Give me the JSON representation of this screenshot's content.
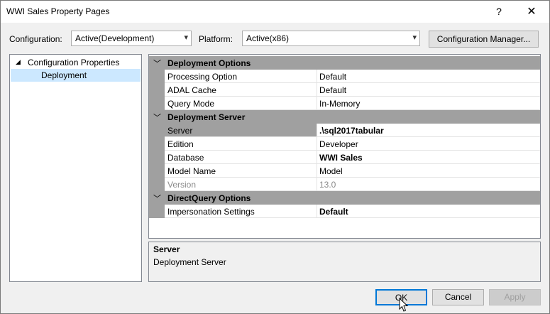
{
  "window": {
    "title": "WWI Sales Property Pages"
  },
  "titlebar": {
    "help": "?",
    "close": "✕"
  },
  "toolbar": {
    "configuration_label": "Configuration:",
    "configuration_value": "Active(Development)",
    "platform_label": "Platform:",
    "platform_value": "Active(x86)",
    "config_manager_label": "Configuration Manager..."
  },
  "tree": {
    "root": {
      "label": "Configuration Properties",
      "expander": "◢"
    },
    "child": {
      "label": "Deployment"
    }
  },
  "grid": {
    "categories": [
      {
        "label": "Deployment Options"
      },
      {
        "label": "Deployment Server"
      },
      {
        "label": "DirectQuery Options"
      }
    ],
    "rows": [
      {
        "name": "Processing Option",
        "value": "Default"
      },
      {
        "name": "ADAL Cache",
        "value": "Default"
      },
      {
        "name": "Query Mode",
        "value": "In-Memory"
      },
      {
        "name": "Server",
        "value": ".\\sql2017tabular"
      },
      {
        "name": "Edition",
        "value": "Developer"
      },
      {
        "name": "Database",
        "value": "WWI Sales"
      },
      {
        "name": "Model Name",
        "value": "Model"
      },
      {
        "name": "Version",
        "value": "13.0"
      },
      {
        "name": "Impersonation Settings",
        "value": "Default"
      }
    ]
  },
  "description": {
    "title": "Server",
    "text": "Deployment Server"
  },
  "buttons": {
    "ok": "OK",
    "cancel": "Cancel",
    "apply": "Apply"
  },
  "colors": {
    "category_bg": "#a0a0a0",
    "selected_bg": "#cce8ff",
    "dialog_bg": "#f0f0f0"
  }
}
